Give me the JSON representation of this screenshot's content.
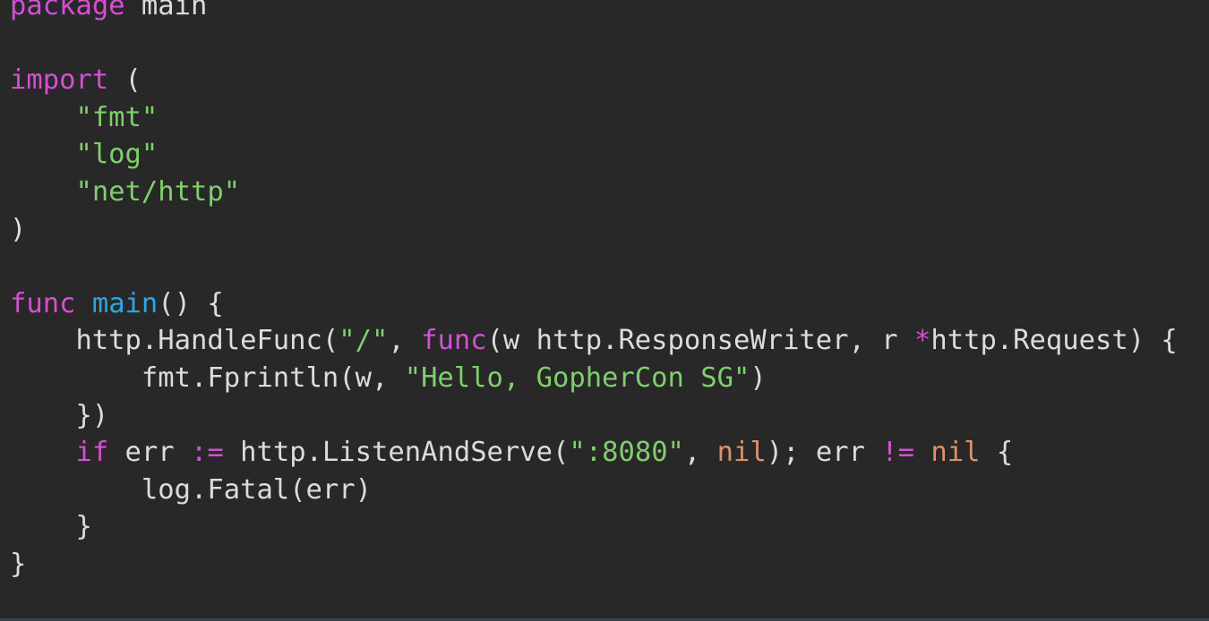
{
  "editor": {
    "language": "Go",
    "colors": {
      "background": "#282828",
      "keyword": "#d54fd4",
      "function": "#2aa7e6",
      "string": "#7fcf6b",
      "literal": "#e0906a",
      "plain": "#dcdcdc"
    },
    "lines": [
      [
        {
          "t": "kw",
          "v": "package"
        },
        {
          "t": "plain",
          "v": " main"
        }
      ],
      [],
      [
        {
          "t": "kw",
          "v": "import"
        },
        {
          "t": "plain",
          "v": " ("
        }
      ],
      [
        {
          "t": "plain",
          "v": "    "
        },
        {
          "t": "str",
          "v": "\"fmt\""
        }
      ],
      [
        {
          "t": "plain",
          "v": "    "
        },
        {
          "t": "str",
          "v": "\"log\""
        }
      ],
      [
        {
          "t": "plain",
          "v": "    "
        },
        {
          "t": "str",
          "v": "\"net/http\""
        }
      ],
      [
        {
          "t": "plain",
          "v": ")"
        }
      ],
      [],
      [
        {
          "t": "kw",
          "v": "func"
        },
        {
          "t": "plain",
          "v": " "
        },
        {
          "t": "fn",
          "v": "main"
        },
        {
          "t": "plain",
          "v": "() {"
        }
      ],
      [
        {
          "t": "plain",
          "v": "    http.HandleFunc("
        },
        {
          "t": "str",
          "v": "\"/\""
        },
        {
          "t": "plain",
          "v": ", "
        },
        {
          "t": "kw",
          "v": "func"
        },
        {
          "t": "plain",
          "v": "(w http.ResponseWriter, r "
        },
        {
          "t": "kw",
          "v": "*"
        },
        {
          "t": "plain",
          "v": "http.Request) {"
        }
      ],
      [
        {
          "t": "plain",
          "v": "        fmt.Fprintln(w, "
        },
        {
          "t": "str",
          "v": "\"Hello, GopherCon SG\""
        },
        {
          "t": "plain",
          "v": ")"
        }
      ],
      [
        {
          "t": "plain",
          "v": "    })"
        }
      ],
      [
        {
          "t": "plain",
          "v": "    "
        },
        {
          "t": "kw",
          "v": "if"
        },
        {
          "t": "plain",
          "v": " err "
        },
        {
          "t": "kw",
          "v": ":="
        },
        {
          "t": "plain",
          "v": " http.ListenAndServe("
        },
        {
          "t": "str",
          "v": "\":8080\""
        },
        {
          "t": "plain",
          "v": ", "
        },
        {
          "t": "lit",
          "v": "nil"
        },
        {
          "t": "plain",
          "v": "); err "
        },
        {
          "t": "kw",
          "v": "!="
        },
        {
          "t": "plain",
          "v": " "
        },
        {
          "t": "lit",
          "v": "nil"
        },
        {
          "t": "plain",
          "v": " {"
        }
      ],
      [
        {
          "t": "plain",
          "v": "        log.Fatal(err)"
        }
      ],
      [
        {
          "t": "plain",
          "v": "    }"
        }
      ],
      [
        {
          "t": "plain",
          "v": "}"
        }
      ]
    ]
  }
}
